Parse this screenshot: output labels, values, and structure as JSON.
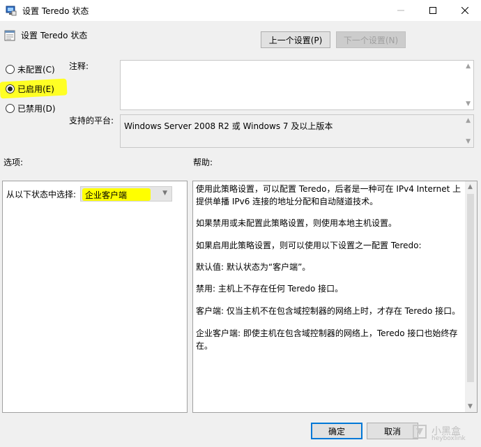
{
  "window": {
    "title": "设置 Teredo 状态",
    "controls": [
      "minimize-icon",
      "maximize-icon",
      "close-icon"
    ]
  },
  "header": {
    "title": "设置 Teredo 状态",
    "prev_button": "上一个设置(P)",
    "next_button": "下一个设置(N)"
  },
  "state_options": [
    {
      "label": "未配置(C)",
      "checked": false
    },
    {
      "label": "已启用(E)",
      "checked": true
    },
    {
      "label": "已禁用(D)",
      "checked": false
    }
  ],
  "comment": {
    "label": "注释:",
    "value": ""
  },
  "platform": {
    "label": "支持的平台:",
    "value": "Windows Server 2008 R2 或 Windows 7 及以上版本"
  },
  "options": {
    "label": "选项:",
    "select_label": "从以下状态中选择:",
    "select_value": "企业客户端"
  },
  "help": {
    "label": "帮助:",
    "paragraphs": [
      "使用此策略设置，可以配置 Teredo，后者是一种可在 IPv4 Internet 上提供单播 IPv6 连接的地址分配和自动隧道技术。",
      "如果禁用或未配置此策略设置，则使用本地主机设置。",
      "如果启用此策略设置，则可以使用以下设置之一配置 Teredo:",
      "默认值: 默认状态为“客户端”。",
      "禁用: 主机上不存在任何 Teredo 接口。",
      "客户端: 仅当主机不在包含域控制器的网络上时，才存在 Teredo 接口。",
      "企业客户端: 即使主机在包含域控制器的网络上，Teredo 接口也始终存在。"
    ]
  },
  "footer": {
    "ok_button": "确定",
    "cancel_button": "取消"
  },
  "watermark": {
    "text": "小黑盒",
    "sub": "heyboxlink"
  },
  "colors": {
    "highlight": "#ffff00",
    "accent": "#0078d7",
    "dialog_bg": "#f0f0f0"
  }
}
